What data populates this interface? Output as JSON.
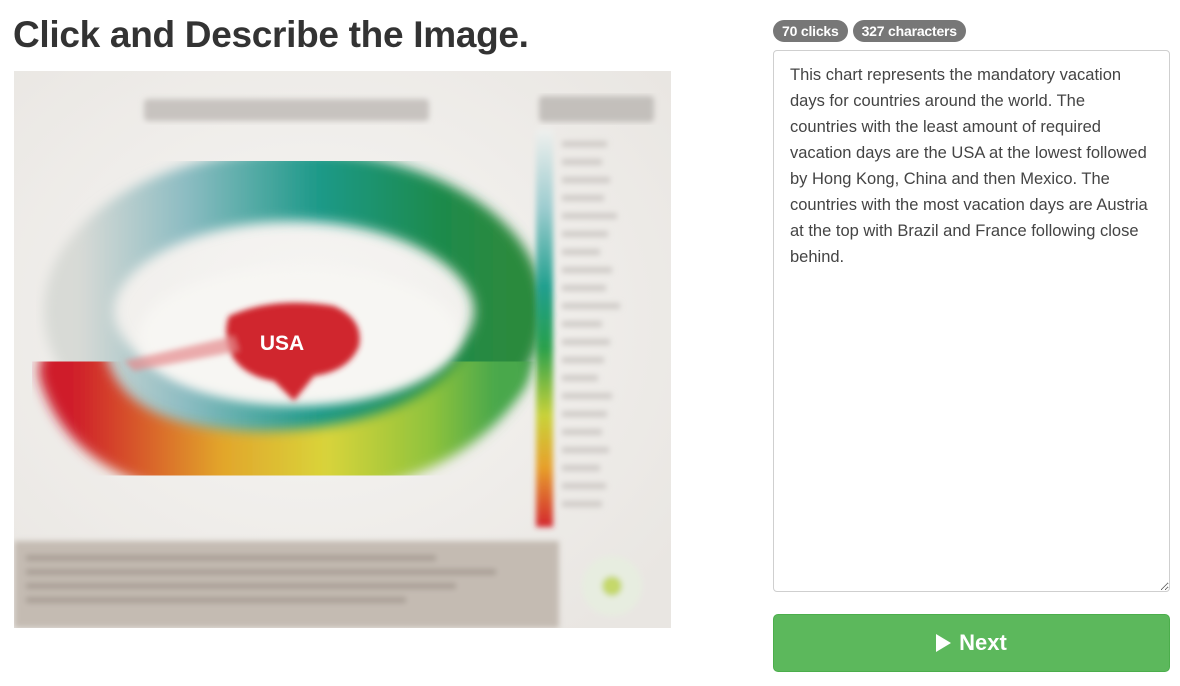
{
  "header": {
    "title": "Click and Describe the Image."
  },
  "image": {
    "center_label": "USA"
  },
  "stats": {
    "clicks_badge": "70 clicks",
    "characters_badge": "327 characters"
  },
  "description": {
    "text": "This chart represents the mandatory vacation days for countries around the world. The countries with the least amount of required vacation days are the USA at the lowest followed by Hong Kong, China and then Mexico. The countries with the most vacation days are Austria at the top with Brazil and France following close behind."
  },
  "actions": {
    "next_label": "Next",
    "next_color": "#5cb85c"
  }
}
